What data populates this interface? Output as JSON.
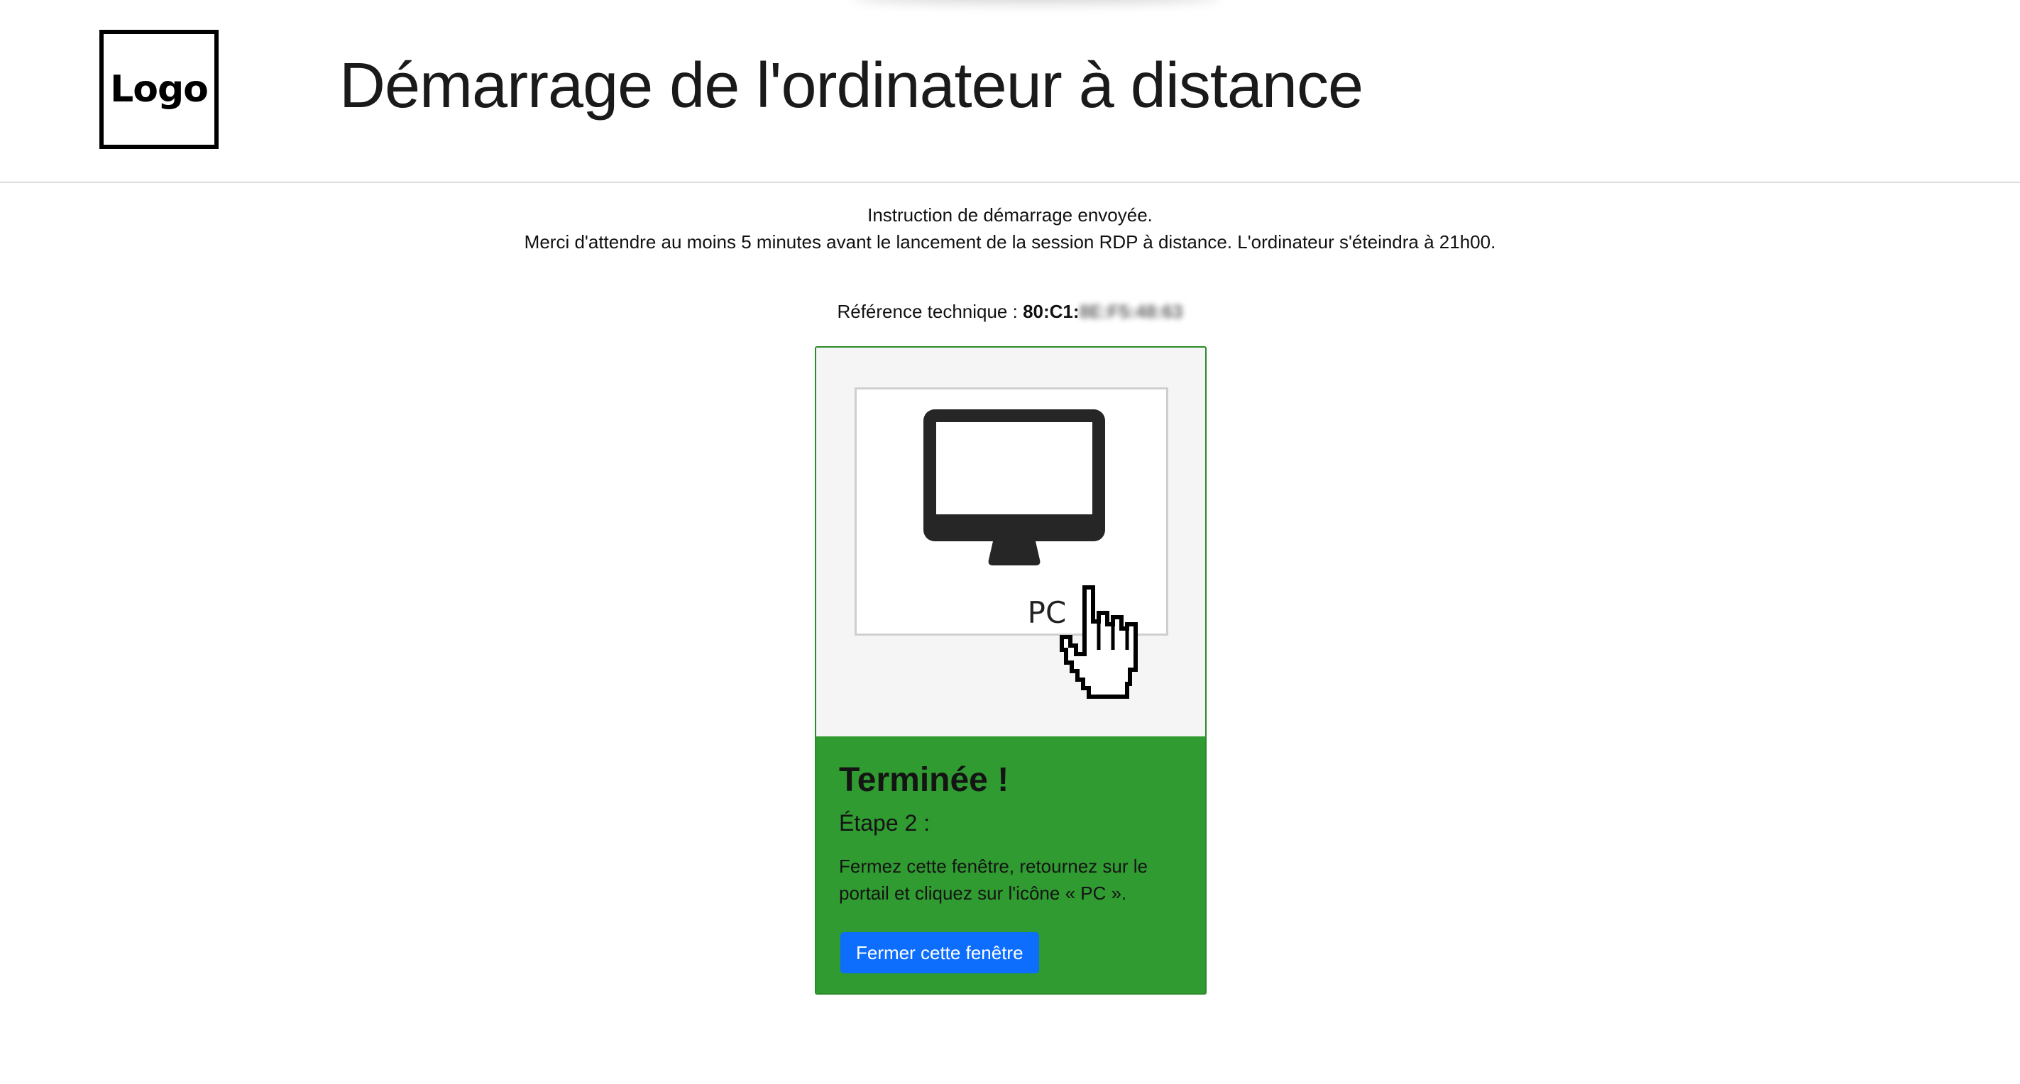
{
  "header": {
    "logo_text": "Logo",
    "title": "Démarrage de l'ordinateur à distance"
  },
  "notice": {
    "line1": "Instruction de démarrage envoyée.",
    "line2": "Merci d'attendre au moins 5 minutes avant le lancement de la session RDP à distance. L'ordinateur s'éteindra à 21h00."
  },
  "reference": {
    "label": "Référence technique :",
    "value_visible": "80:C1:",
    "value_blurred": "8E:F5:48:63"
  },
  "card": {
    "media": {
      "pc_label": "PC",
      "computer_icon": "monitor-icon",
      "cursor_icon": "hand-pointer-icon"
    },
    "title": "Terminée !",
    "step": "Étape 2 :",
    "instructions": "Fermez cette fenêtre, retournez sur le portail et cliquez sur l'icône « PC ».",
    "button_label": "Fermer cette fenêtre"
  },
  "colors": {
    "success_green": "#309b31",
    "button_blue": "#0d6efd",
    "card_border": "#2a8a2a"
  }
}
